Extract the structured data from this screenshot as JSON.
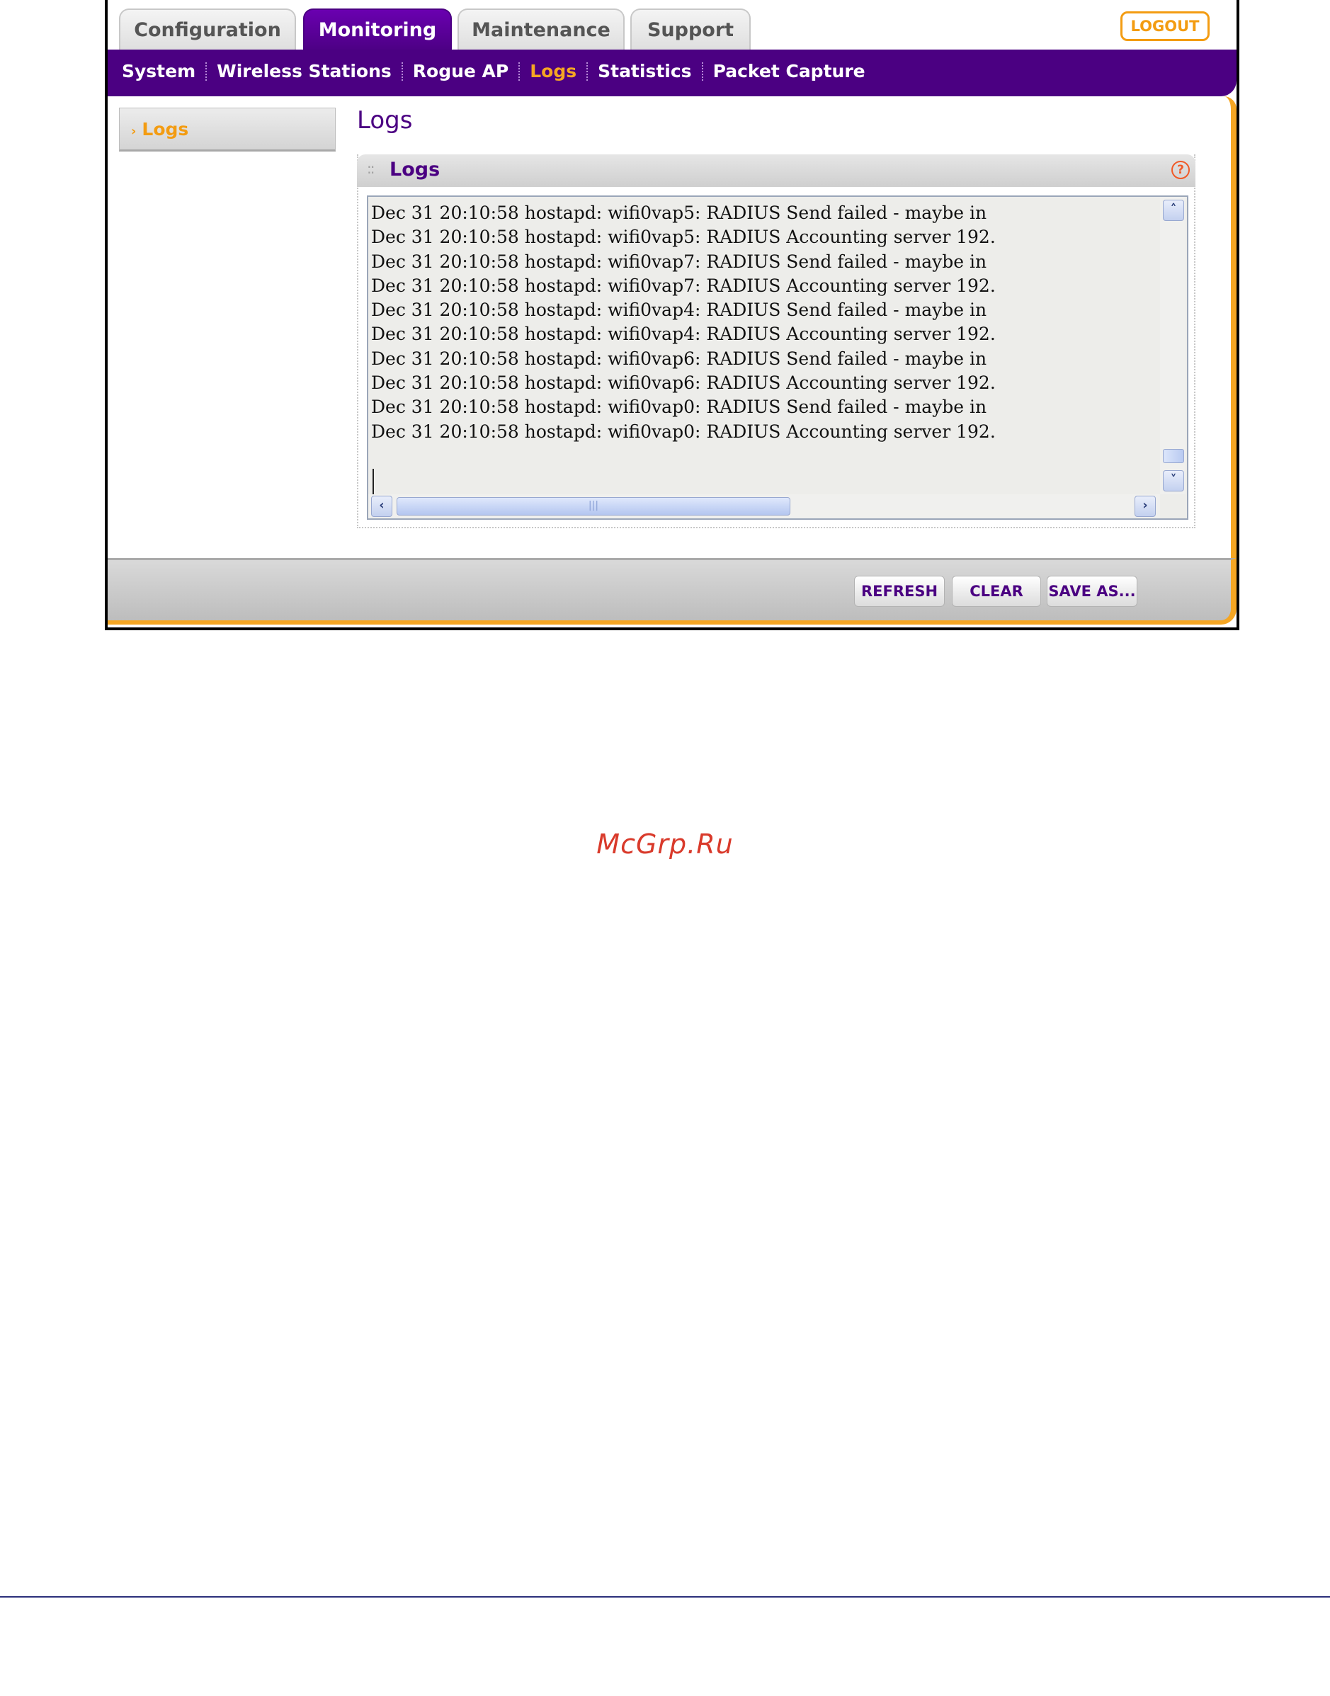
{
  "tabs": [
    {
      "label": "Configuration",
      "active": false
    },
    {
      "label": "Monitoring",
      "active": true
    },
    {
      "label": "Maintenance",
      "active": false
    },
    {
      "label": "Support",
      "active": false
    }
  ],
  "logout_label": "LOGOUT",
  "subnav": [
    {
      "label": "System",
      "active": false
    },
    {
      "label": "Wireless Stations",
      "active": false
    },
    {
      "label": "Rogue AP",
      "active": false
    },
    {
      "label": "Logs",
      "active": true
    },
    {
      "label": "Statistics",
      "active": false
    },
    {
      "label": "Packet Capture",
      "active": false
    }
  ],
  "sidebar": {
    "items": [
      {
        "label": "Logs",
        "active": true
      }
    ]
  },
  "page_title": "Logs",
  "panel": {
    "title": "Logs",
    "help": "?"
  },
  "log_lines": [
    "Dec 31 20:10:58 hostapd: wifi0vap5: RADIUS Send failed - maybe in",
    "Dec 31 20:10:58 hostapd: wifi0vap5: RADIUS Accounting server 192.",
    "Dec 31 20:10:58 hostapd: wifi0vap7: RADIUS Send failed - maybe in",
    "Dec 31 20:10:58 hostapd: wifi0vap7: RADIUS Accounting server 192.",
    "Dec 31 20:10:58 hostapd: wifi0vap4: RADIUS Send failed - maybe in",
    "Dec 31 20:10:58 hostapd: wifi0vap4: RADIUS Accounting server 192.",
    "Dec 31 20:10:58 hostapd: wifi0vap6: RADIUS Send failed - maybe in",
    "Dec 31 20:10:58 hostapd: wifi0vap6: RADIUS Accounting server 192.",
    "Dec 31 20:10:58 hostapd: wifi0vap0: RADIUS Send failed - maybe in",
    "Dec 31 20:10:58 hostapd: wifi0vap0: RADIUS Accounting server 192."
  ],
  "buttons": {
    "refresh": "REFRESH",
    "clear": "CLEAR",
    "save_as": "SAVE AS..."
  },
  "icons": {
    "scroll_up": "chevron-up-icon",
    "scroll_down": "chevron-down-icon",
    "scroll_left": "chevron-left-icon",
    "scroll_right": "chevron-right-icon",
    "help": "help-icon"
  },
  "watermark": "McGrp.Ru",
  "colors": {
    "brand_purple": "#4b0082",
    "accent_orange": "#f5a623",
    "active_text": "#f39c12"
  }
}
